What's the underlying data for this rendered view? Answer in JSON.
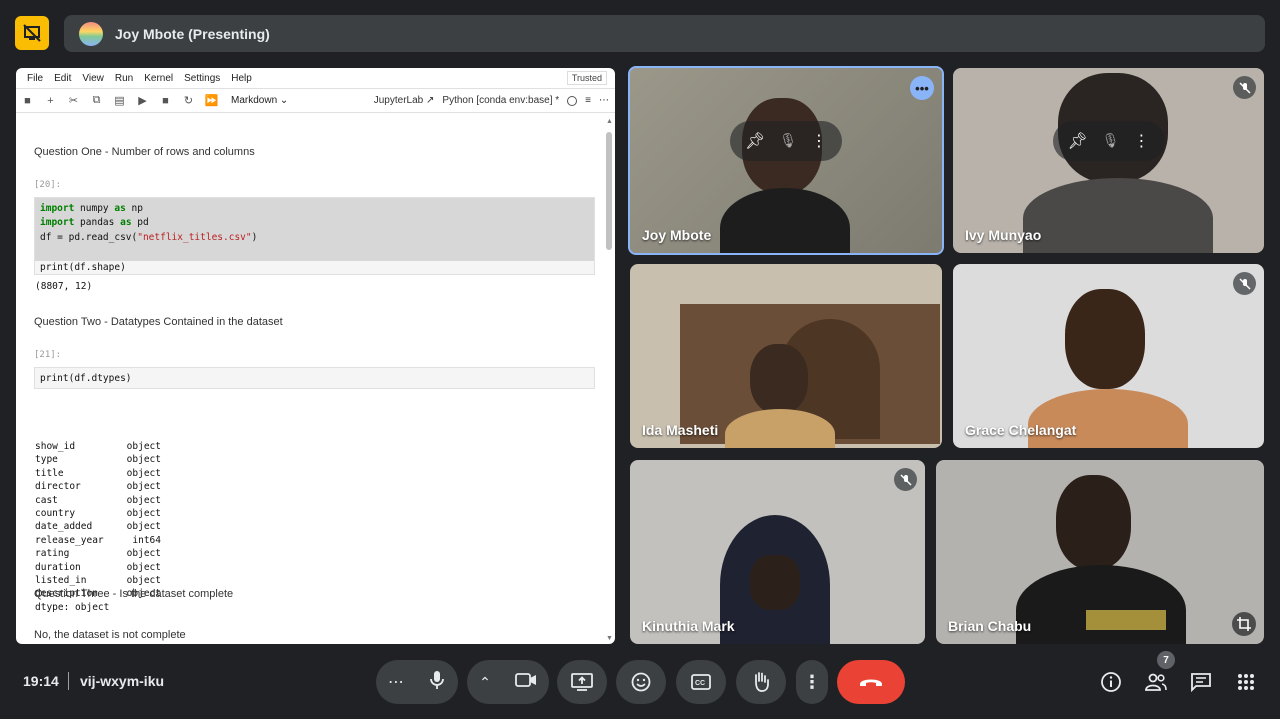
{
  "presenting": {
    "title": "Joy Mbote (Presenting)"
  },
  "jupyter": {
    "menu": [
      "File",
      "Edit",
      "View",
      "Run",
      "Kernel",
      "Settings",
      "Help"
    ],
    "trusted": "Trusted",
    "cell_type": "Markdown",
    "app_link": "JupyterLab",
    "kernel": "Python [conda env:base] *",
    "cells": {
      "q1": "Question One - Number of rows and columns",
      "prompt1": "[20]:",
      "code1_lines": [
        "import numpy as np",
        "import pandas as pd",
        "df = pd.read_csv(\"netflix_titles.csv\")",
        "",
        "print(df.shape)"
      ],
      "out1": "(8807, 12)",
      "q2": "Question Two - Datatypes Contained in the dataset",
      "prompt2": "[21]:",
      "code2": "print(df.dtypes)",
      "dtypes": [
        [
          "show_id",
          "object"
        ],
        [
          "type",
          "object"
        ],
        [
          "title",
          "object"
        ],
        [
          "director",
          "object"
        ],
        [
          "cast",
          "object"
        ],
        [
          "country",
          "object"
        ],
        [
          "date_added",
          "object"
        ],
        [
          "release_year",
          "int64"
        ],
        [
          "rating",
          "object"
        ],
        [
          "duration",
          "object"
        ],
        [
          "listed_in",
          "object"
        ],
        [
          "description",
          "object"
        ]
      ],
      "dtype_footer": "dtype: object",
      "q3": "Question Three - Is the dataset complete",
      "answer3": "No, the dataset is not complete"
    }
  },
  "participants": [
    {
      "name": "Joy Mbote"
    },
    {
      "name": "Ivy Munyao"
    },
    {
      "name": "Ida Masheti"
    },
    {
      "name": "Grace Chelangat"
    },
    {
      "name": "Kinuthia Mark"
    },
    {
      "name": "Brian Chabu"
    }
  ],
  "bottom": {
    "time": "19:14",
    "meeting_code": "vij-wxym-iku",
    "people_count": "7"
  },
  "colors": {
    "accent": "#8ab4f8",
    "hangup": "#ea4335",
    "logo": "#fbbc04"
  }
}
